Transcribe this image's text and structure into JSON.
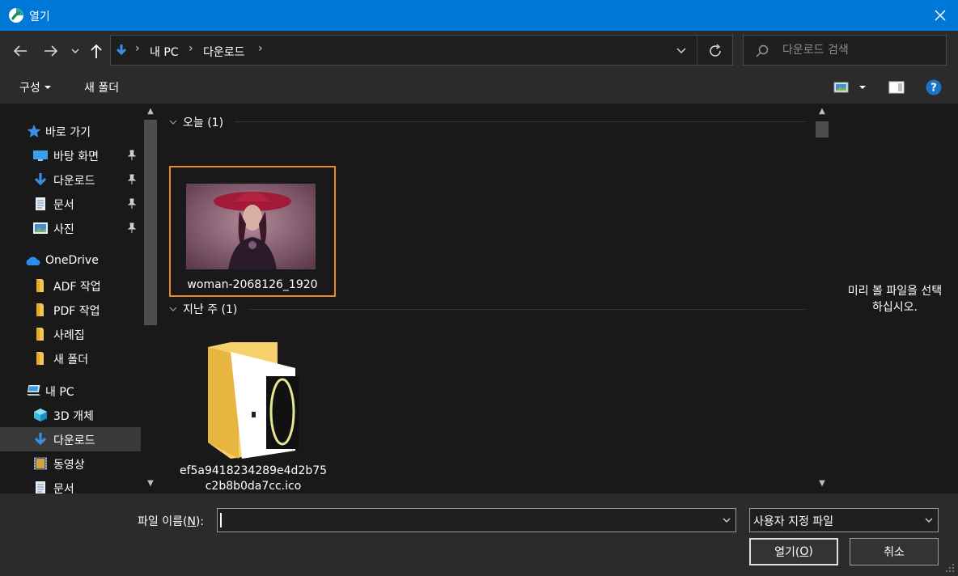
{
  "window": {
    "title": "열기",
    "app_icon": "app-logo-icon",
    "close_icon": "close-icon"
  },
  "nav": {
    "back_icon": "back-arrow-icon",
    "forward_icon": "forward-arrow-icon",
    "recent_icon": "chevron-down-icon",
    "up_icon": "up-arrow-icon",
    "breadcrumb": [
      "내 PC",
      "다운로드"
    ],
    "refresh_icon": "refresh-icon",
    "search_placeholder": "다운로드 검색"
  },
  "toolbar": {
    "organize_label": "구성",
    "new_folder_label": "새 폴더",
    "view_icon": "view-options-icon",
    "preview_pane_icon": "preview-pane-icon",
    "help_icon": "help-icon"
  },
  "sidebar": {
    "quick_access": "바로 가기",
    "quick_items": [
      {
        "label": "바탕 화면",
        "icon": "desktop-icon",
        "pinned": true
      },
      {
        "label": "다운로드",
        "icon": "download-icon",
        "pinned": true
      },
      {
        "label": "문서",
        "icon": "document-icon",
        "pinned": true
      },
      {
        "label": "사진",
        "icon": "pictures-icon",
        "pinned": true
      }
    ],
    "onedrive": "OneDrive",
    "onedrive_items": [
      {
        "label": "ADF 작업",
        "icon": "folder-icon"
      },
      {
        "label": "PDF 작업",
        "icon": "folder-icon"
      },
      {
        "label": "사례집",
        "icon": "folder-icon"
      },
      {
        "label": "새 폴더",
        "icon": "folder-icon"
      }
    ],
    "this_pc": "내 PC",
    "pc_items": [
      {
        "label": "3D 개체",
        "icon": "3d-objects-icon"
      },
      {
        "label": "다운로드",
        "icon": "download-icon",
        "selected": true
      },
      {
        "label": "동영상",
        "icon": "video-icon"
      },
      {
        "label": "문서",
        "icon": "document-icon"
      }
    ]
  },
  "content": {
    "groups": [
      {
        "header": "오늘 (1)",
        "files": [
          {
            "name": "woman-2068126_1920",
            "type": "image",
            "selected": true
          }
        ]
      },
      {
        "header": "지난 주 (1)",
        "files": [
          {
            "name_line1": "ef5a9418234289e4d2b75",
            "name_line2": "c2b8b0da7cc.ico",
            "type": "folder-with-ico"
          }
        ]
      }
    ]
  },
  "preview": {
    "message_line1": "미리 볼 파일을 선택",
    "message_line2": "하십시오."
  },
  "footer": {
    "filename_label_prefix": "파일 이름(",
    "filename_label_key": "N",
    "filename_label_suffix": "):",
    "filename_value": "",
    "file_type_value": "사용자 지정 파일",
    "open_prefix": "열기(",
    "open_key": "O",
    "open_suffix": ")",
    "cancel_label": "취소"
  }
}
